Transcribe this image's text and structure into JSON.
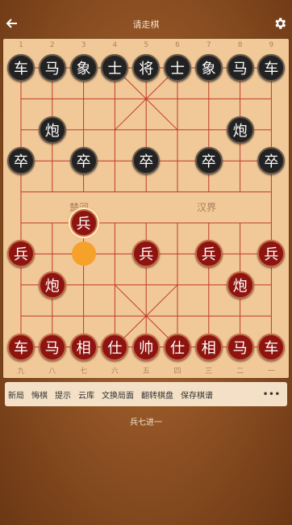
{
  "header": {
    "title": "请走棋"
  },
  "board": {
    "top_numbers": [
      "1",
      "2",
      "3",
      "4",
      "5",
      "6",
      "7",
      "8",
      "9"
    ],
    "bottom_numbers": [
      "九",
      "八",
      "七",
      "六",
      "五",
      "四",
      "三",
      "二",
      "一"
    ],
    "river_left": "楚河",
    "river_right": "汉界",
    "pieces": [
      {
        "c": "车",
        "side": "black",
        "col": 0,
        "row": 0
      },
      {
        "c": "马",
        "side": "black",
        "col": 1,
        "row": 0
      },
      {
        "c": "象",
        "side": "black",
        "col": 2,
        "row": 0
      },
      {
        "c": "士",
        "side": "black",
        "col": 3,
        "row": 0
      },
      {
        "c": "将",
        "side": "black",
        "col": 4,
        "row": 0
      },
      {
        "c": "士",
        "side": "black",
        "col": 5,
        "row": 0
      },
      {
        "c": "象",
        "side": "black",
        "col": 6,
        "row": 0
      },
      {
        "c": "马",
        "side": "black",
        "col": 7,
        "row": 0
      },
      {
        "c": "车",
        "side": "black",
        "col": 8,
        "row": 0
      },
      {
        "c": "炮",
        "side": "black",
        "col": 1,
        "row": 2
      },
      {
        "c": "炮",
        "side": "black",
        "col": 7,
        "row": 2
      },
      {
        "c": "卒",
        "side": "black",
        "col": 0,
        "row": 3
      },
      {
        "c": "卒",
        "side": "black",
        "col": 2,
        "row": 3
      },
      {
        "c": "卒",
        "side": "black",
        "col": 4,
        "row": 3
      },
      {
        "c": "卒",
        "side": "black",
        "col": 6,
        "row": 3
      },
      {
        "c": "卒",
        "side": "black",
        "col": 8,
        "row": 3
      },
      {
        "c": "兵",
        "side": "red",
        "col": 2,
        "row": 5,
        "selected": true
      },
      {
        "c": "兵",
        "side": "red",
        "col": 0,
        "row": 6
      },
      {
        "c": "兵",
        "side": "red",
        "col": 4,
        "row": 6
      },
      {
        "c": "兵",
        "side": "red",
        "col": 6,
        "row": 6
      },
      {
        "c": "兵",
        "side": "red",
        "col": 8,
        "row": 6
      },
      {
        "c": "炮",
        "side": "red",
        "col": 1,
        "row": 7
      },
      {
        "c": "炮",
        "side": "red",
        "col": 7,
        "row": 7
      },
      {
        "c": "车",
        "side": "red",
        "col": 0,
        "row": 9
      },
      {
        "c": "马",
        "side": "red",
        "col": 1,
        "row": 9
      },
      {
        "c": "相",
        "side": "red",
        "col": 2,
        "row": 9
      },
      {
        "c": "仕",
        "side": "red",
        "col": 3,
        "row": 9
      },
      {
        "c": "帅",
        "side": "red",
        "col": 4,
        "row": 9
      },
      {
        "c": "仕",
        "side": "red",
        "col": 5,
        "row": 9
      },
      {
        "c": "相",
        "side": "red",
        "col": 6,
        "row": 9
      },
      {
        "c": "马",
        "side": "red",
        "col": 7,
        "row": 9
      },
      {
        "c": "车",
        "side": "red",
        "col": 8,
        "row": 9
      }
    ],
    "move_from": {
      "col": 2,
      "row": 6
    }
  },
  "toolbar": {
    "items": [
      "新局",
      "悔棋",
      "提示",
      "云库",
      "文换局面",
      "翻转棋盘",
      "保存棋谱"
    ],
    "more": "•••"
  },
  "status": {
    "move_text": "兵七进一"
  },
  "colors": {
    "black_piece": "#222222",
    "red_piece": "#8e1410",
    "highlight": "#f6a12a",
    "line": "#c0392b"
  }
}
